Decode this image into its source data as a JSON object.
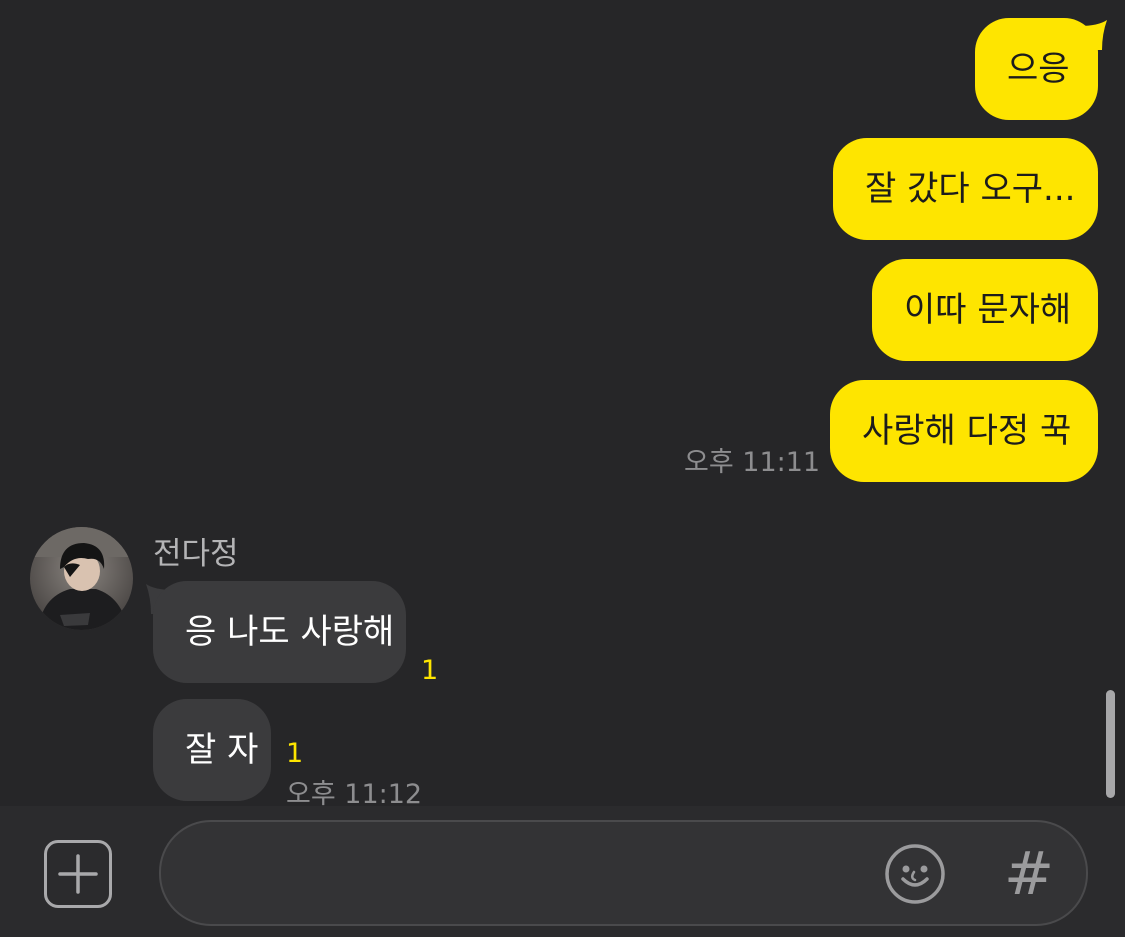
{
  "chat": {
    "outgoing_messages": [
      {
        "text": "으응"
      },
      {
        "text": "잘 갔다 오구..."
      },
      {
        "text": "이따 문자해"
      },
      {
        "text": "사랑해 다정 꾹"
      }
    ],
    "outgoing_time": "오후 11:11",
    "incoming_group": {
      "sender_name": "전다정",
      "avatar_icon": "user-photo-avatar",
      "messages": [
        {
          "text": "응 나도 사랑해",
          "unread_count": "1"
        },
        {
          "text": "잘 자",
          "unread_count": "1"
        }
      ],
      "time": "오후 11:12"
    }
  },
  "input_bar": {
    "plus_icon": "plus-square-icon",
    "message_value": "",
    "emoji_icon": "smiley-icon",
    "hash_label": "#"
  },
  "colors": {
    "background": "#262628",
    "outgoing_bubble": "#FEE500",
    "incoming_bubble": "#3b3b3d",
    "unread_badge": "#FEE500",
    "timestamp": "#8d8d8f"
  }
}
